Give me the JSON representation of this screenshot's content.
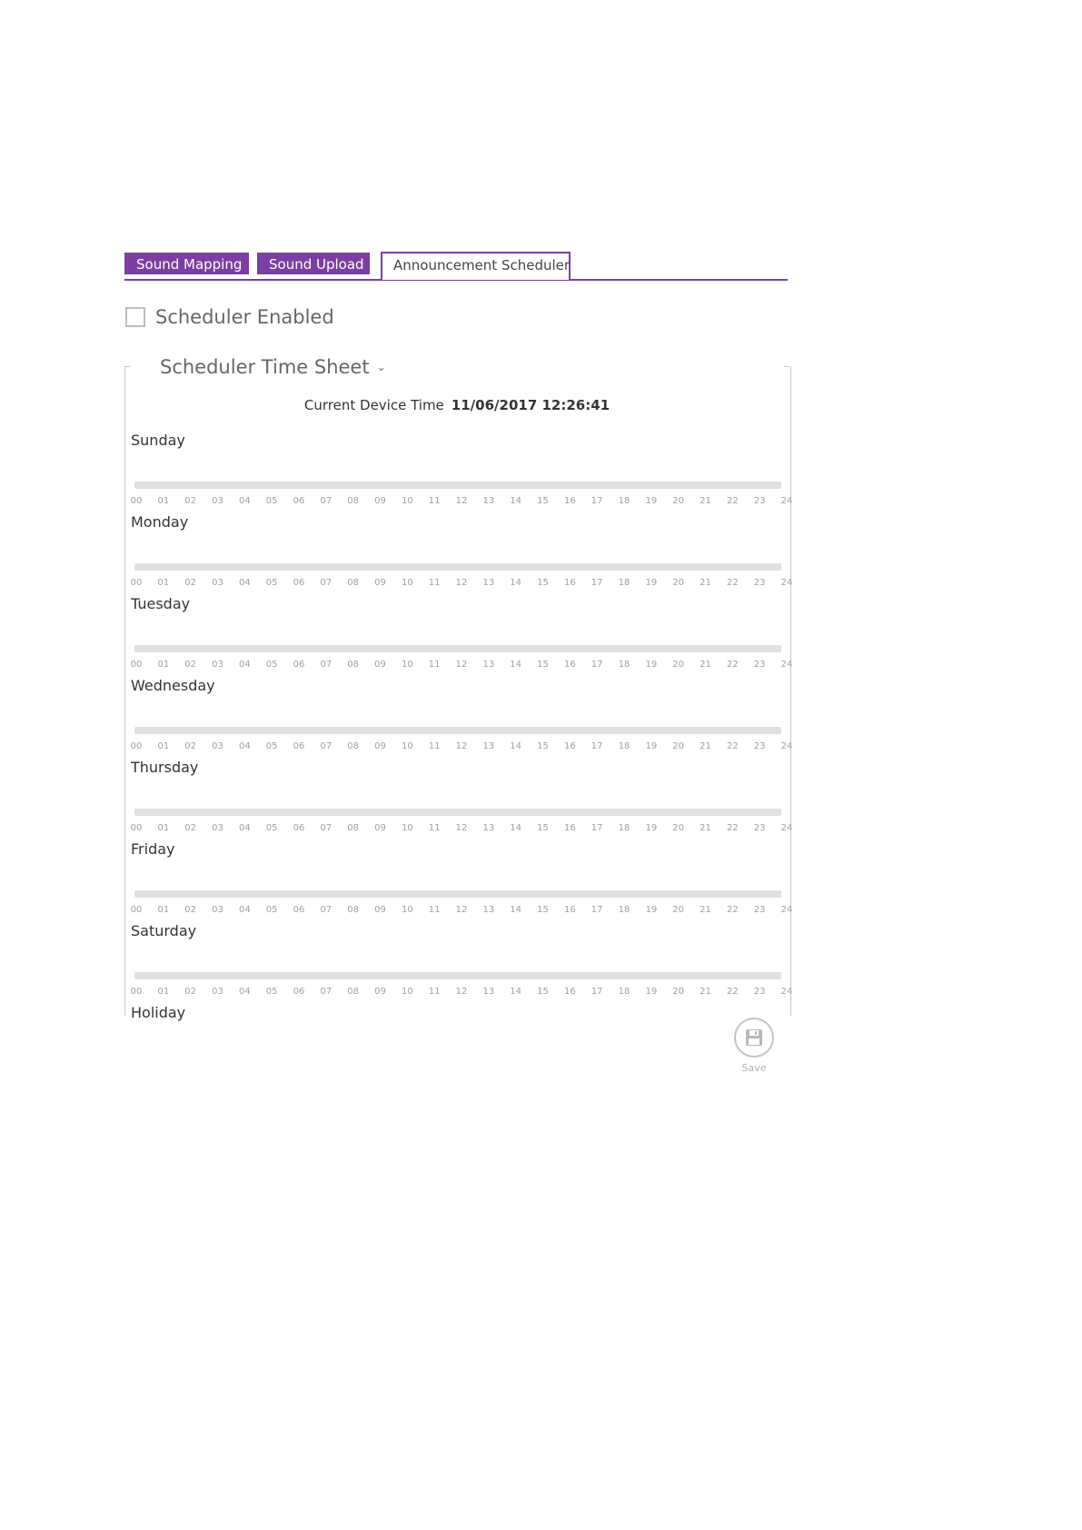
{
  "tabs": [
    {
      "label": "Sound Mapping"
    },
    {
      "label": "Sound Upload"
    },
    {
      "label": "Announcement Scheduler"
    }
  ],
  "scheduler": {
    "enabled_label": "Scheduler Enabled",
    "enabled": false
  },
  "time_sheet": {
    "title": "Scheduler Time Sheet",
    "device_time_label": "Current Device Time",
    "device_time_value": "11/06/2017 12:26:41"
  },
  "days": [
    {
      "label": "Sunday"
    },
    {
      "label": "Monday"
    },
    {
      "label": "Tuesday"
    },
    {
      "label": "Wednesday"
    },
    {
      "label": "Thursday"
    },
    {
      "label": "Friday"
    },
    {
      "label": "Saturday"
    },
    {
      "label": "Holiday"
    }
  ],
  "hours": [
    "00",
    "01",
    "02",
    "03",
    "04",
    "05",
    "06",
    "07",
    "08",
    "09",
    "10",
    "11",
    "12",
    "13",
    "14",
    "15",
    "16",
    "17",
    "18",
    "19",
    "20",
    "21",
    "22",
    "23",
    "24"
  ],
  "save": {
    "label": "Save",
    "icon": "floppy-disk-icon"
  },
  "colors": {
    "accent": "#7b3fa2",
    "track": "#e0e0e0",
    "axis_text": "#a0a0a0"
  }
}
